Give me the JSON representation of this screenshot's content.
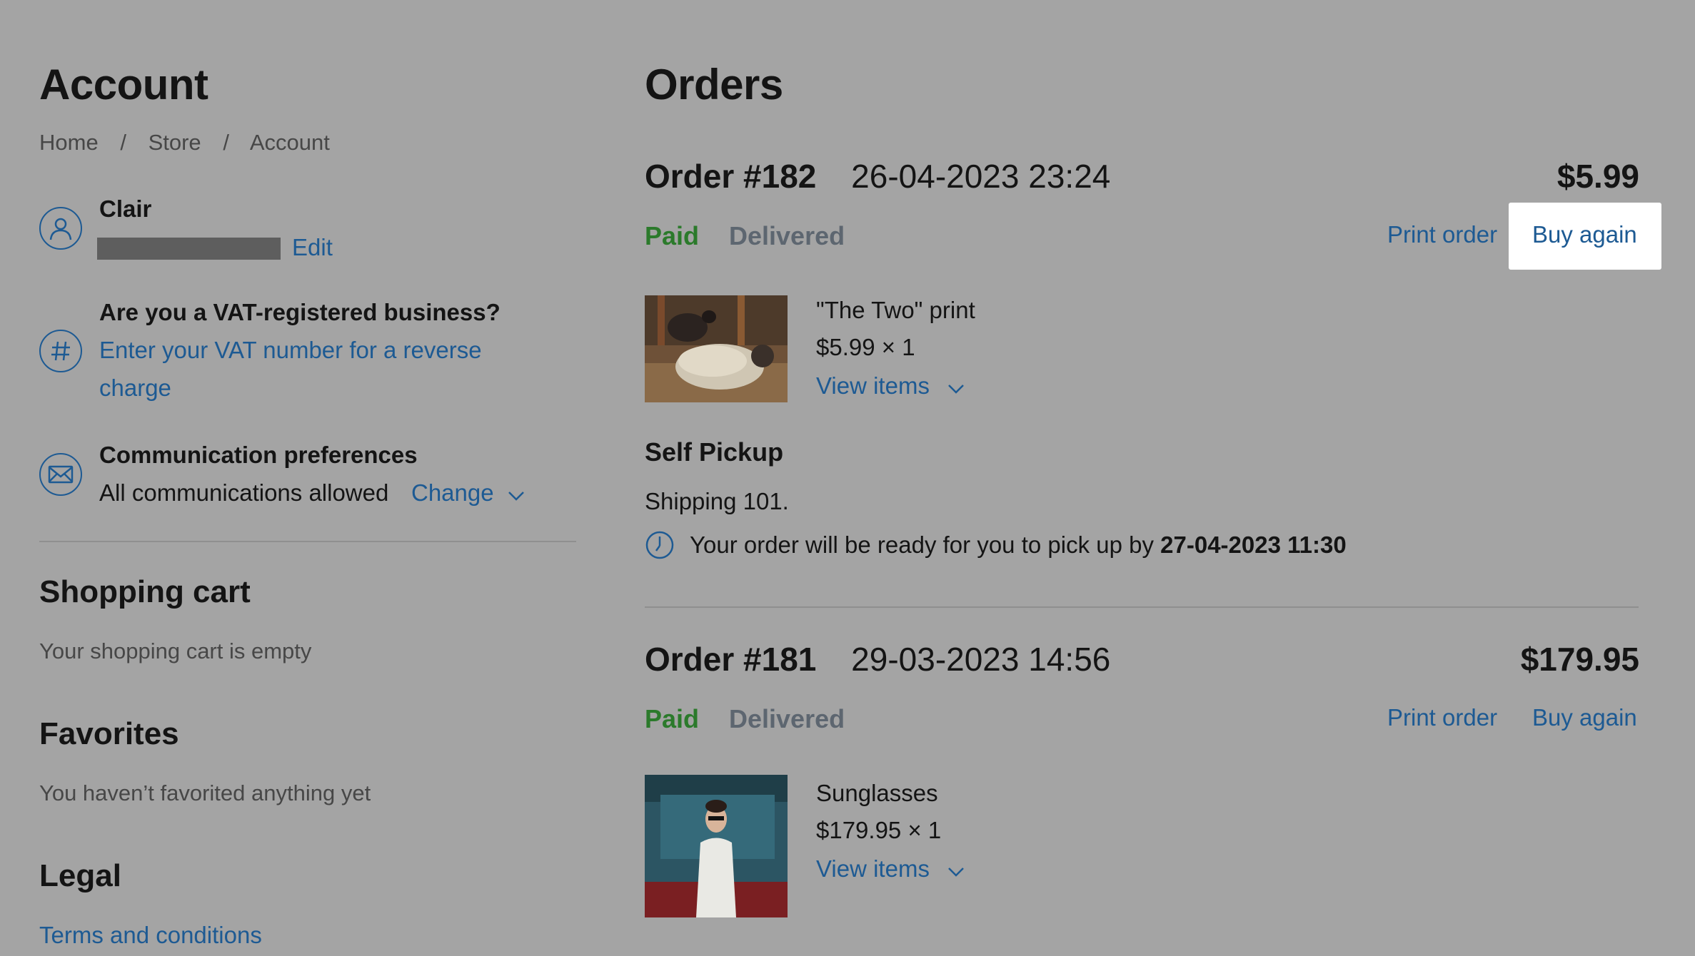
{
  "account": {
    "title": "Account",
    "breadcrumb": {
      "home": "Home",
      "store": "Store",
      "account": "Account",
      "separator": "/"
    },
    "user": {
      "name": "Clair",
      "edit_label": "Edit"
    },
    "vat": {
      "question": "Are you a VAT-registered business?",
      "link_line1": "Enter your VAT number for a reverse",
      "link_line2": "charge"
    },
    "communication": {
      "title": "Communication preferences",
      "status": "All communications allowed",
      "change_label": "Change"
    }
  },
  "shopping_cart": {
    "title": "Shopping cart",
    "empty_text": "Your shopping cart is empty"
  },
  "favorites": {
    "title": "Favorites",
    "empty_text": "You haven’t favorited anything yet"
  },
  "legal": {
    "title": "Legal",
    "terms_link": "Terms and conditions"
  },
  "orders": {
    "title": "Orders",
    "list": [
      {
        "number": "Order #182",
        "date": "26-04-2023 23:24",
        "total": "$5.99",
        "payment_status": "Paid",
        "delivery_status": "Delivered",
        "print_label": "Print order",
        "buy_again_label": "Buy again",
        "item_name": "\"The Two\" print",
        "item_price": "$5.99 × 1",
        "view_items_label": "View items",
        "pickup_title": "Self Pickup",
        "shipping_text": "Shipping 101.",
        "pickup_notice": "Your order will be ready for you to pick up by",
        "pickup_time": "27-04-2023 11:30"
      },
      {
        "number": "Order #181",
        "date": "29-03-2023 14:56",
        "total": "$179.95",
        "payment_status": "Paid",
        "delivery_status": "Delivered",
        "print_label": "Print order",
        "buy_again_label": "Buy again",
        "item_name": "Sunglasses",
        "item_price": "$179.95 × 1",
        "view_items_label": "View items"
      }
    ]
  },
  "colors": {
    "background": "#a4a4a4",
    "link": "#1d5a93",
    "paid": "#2b7a2b",
    "delivered": "#5d6670",
    "highlight": "#ffffff"
  }
}
